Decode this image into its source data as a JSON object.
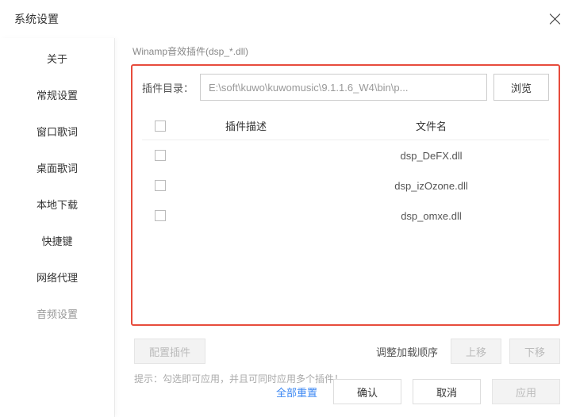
{
  "header": {
    "title": "系统设置"
  },
  "sidebar": {
    "items": [
      {
        "label": "关于"
      },
      {
        "label": "常规设置"
      },
      {
        "label": "窗口歌词"
      },
      {
        "label": "桌面歌词"
      },
      {
        "label": "本地下载"
      },
      {
        "label": "快捷键"
      },
      {
        "label": "网络代理"
      },
      {
        "label": "音频设置"
      }
    ],
    "active_index": 7
  },
  "plugin_section": {
    "title": "Winamp音效插件(dsp_*.dll)",
    "dir_label": "插件目录：",
    "dir_value": "E:\\soft\\kuwo\\kuwomusic\\9.1.1.6_W4\\bin\\p...",
    "browse": "浏览",
    "columns": {
      "desc": "插件描述",
      "file": "文件名"
    },
    "rows": [
      {
        "desc": "",
        "file": "dsp_DeFX.dll"
      },
      {
        "desc": "",
        "file": "dsp_izOzone.dll"
      },
      {
        "desc": "",
        "file": "dsp_omxe.dll"
      }
    ]
  },
  "controls": {
    "configure": "配置插件",
    "adjust_label": "调整加载顺序",
    "move_up": "上移",
    "move_down": "下移",
    "hint": "提示：勾选即可应用，并且可同时应用多个插件！"
  },
  "footer": {
    "reset": "全部重置",
    "ok": "确认",
    "cancel": "取消",
    "apply": "应用"
  }
}
